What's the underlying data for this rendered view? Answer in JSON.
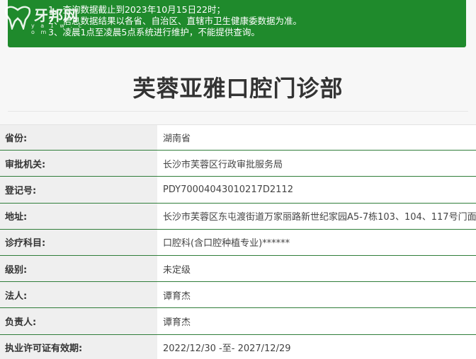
{
  "notice": {
    "lines": [
      "1、查询数据截止到2023年10月15日22时；",
      "2、信息数据结果以各省、自治区、直辖市卫生健康委数据为准。",
      "3、凌晨1点至凌晨5点系统进行维护，不能提供查询。"
    ]
  },
  "logo": {
    "text": "牙邦网",
    "sub": "y a 1 w . c o m"
  },
  "page": {
    "title": "芙蓉亚雅口腔门诊部"
  },
  "fields": [
    {
      "label": "省份:",
      "value": "湖南省"
    },
    {
      "label": "审批机关:",
      "value": "长沙市芙蓉区行政审批服务局"
    },
    {
      "label": "登记号:",
      "value": "PDY70004043010217D2112"
    },
    {
      "label": "地址:",
      "value": "长沙市芙蓉区东屯渡街道万家丽路新世纪家园A5-7栋103、104、117号门面"
    },
    {
      "label": "诊疗科目:",
      "value": "口腔科(含口腔种植专业)******"
    },
    {
      "label": "级别:",
      "value": "未定级"
    },
    {
      "label": "法人:",
      "value": "谭育杰"
    },
    {
      "label": "负责人:",
      "value": "谭育杰"
    },
    {
      "label": "执业许可证有效期:",
      "value": "2022/12/30 -至- 2027/12/29"
    }
  ]
}
